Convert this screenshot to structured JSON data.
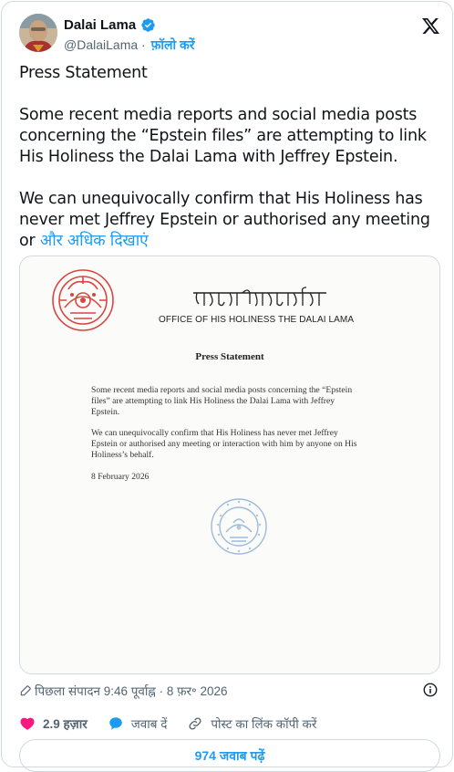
{
  "author": {
    "name": "Dalai Lama",
    "handle": "@DalaiLama",
    "separator": "·",
    "follow_label": "फ़ॉलो करें",
    "verified_icon": "verified-badge-icon"
  },
  "tweet": {
    "paragraphs": [
      "Press Statement",
      "Some recent media reports and social media posts concerning the “Epstein files” are attempting to link His Holiness the Dalai Lama with Jeffrey Epstein.",
      "We can unequivocally confirm that His Holiness has never met Jeffrey Epstein or authorised any meeting or"
    ],
    "show_more_label": "और अधिक दिखाएं"
  },
  "document": {
    "office": "OFFICE OF HIS HOLINESS THE DALAI LAMA",
    "title": "Press Statement",
    "paragraphs": [
      "Some recent media reports and social media posts concerning the “Epstein files” are attempting to link His Holiness the Dalai Lama with Jeffrey Epstein.",
      "We can unequivocally confirm that His Holiness has never met Jeffrey Epstein or authorised any meeting or interaction with him by anyone on His Holiness’s behalf."
    ],
    "date": "8 February 2026"
  },
  "meta": {
    "edited": "पिछला संपादन 9:46 पूर्वाह्न · 8 फ़र॰ 2026"
  },
  "actions": {
    "likes": "2.9 हज़ार",
    "reply": "जवाब दें",
    "copy_link": "पोस्ट का लिंक कॉपी करें"
  },
  "read_replies": "974 जवाब पढ़ें",
  "colors": {
    "accent": "#1d9bf0",
    "like": "#f91880",
    "muted": "#536471",
    "emblem_red": "#d8463f",
    "seal_blue": "#7ea6cf"
  }
}
